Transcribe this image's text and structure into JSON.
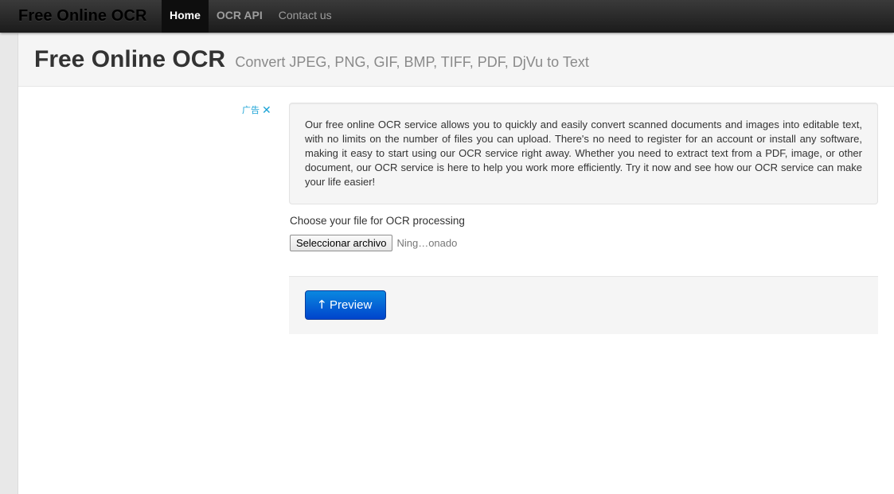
{
  "navbar": {
    "brand": "Free Online OCR",
    "items": [
      {
        "label": "Home",
        "active": true
      },
      {
        "label": "OCR API",
        "active": false
      },
      {
        "label": "Contact us",
        "active": false
      }
    ]
  },
  "header": {
    "title": "Free Online OCR",
    "subtitle": "Convert JPEG, PNG, GIF, BMP, TIFF, PDF, DjVu to Text"
  },
  "ad": {
    "label": "广告",
    "close_icon": "close-icon"
  },
  "intro": {
    "text": "Our free online OCR service allows you to quickly and easily convert scanned documents and images into editable text, with no limits on the number of files you can upload. There's no need to register for an account or install any software, making it easy to start using our OCR service right away. Whether you need to extract text from a PDF, image, or other document, our OCR service is here to help you work more efficiently. Try it now and see how our OCR service can make your life easier!"
  },
  "upload": {
    "label": "Choose your file for OCR processing",
    "button_label": "Seleccionar archivo",
    "status": "Ning…onado"
  },
  "actions": {
    "preview_label": "Preview",
    "preview_icon": "arrow-up-icon"
  },
  "colors": {
    "accent": "#0055cc",
    "navbar": "#222222",
    "ad_link": "#1aa3d6"
  }
}
